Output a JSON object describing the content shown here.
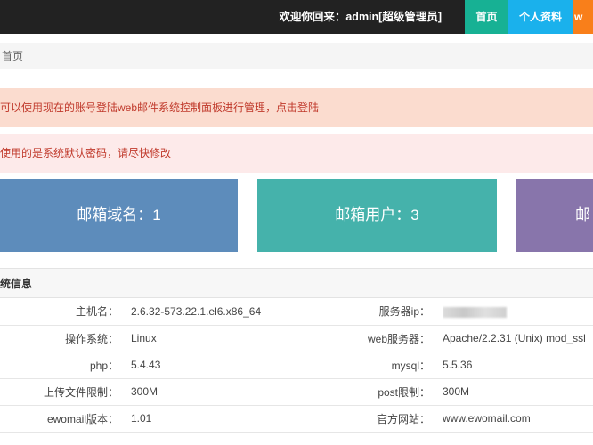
{
  "header": {
    "welcome_text": "欢迎你回来：admin[超级管理员]",
    "nav": [
      {
        "label": "首页",
        "color": "#17b194"
      },
      {
        "label": "个人资料",
        "color": "#1ab1ec"
      },
      {
        "label": "w",
        "color": "#f97f1a"
      }
    ]
  },
  "breadcrumb": {
    "current": "首页"
  },
  "alerts": [
    {
      "text": "可以使用现在的账号登陆web邮件系统控制面板进行管理，点击登陆"
    },
    {
      "text": "使用的是系统默认密码，请尽快修改"
    }
  ],
  "stats": [
    {
      "label": "邮箱域名：1",
      "color": "#5d8cbb"
    },
    {
      "label": "邮箱用户：3",
      "color": "#45b2ab"
    },
    {
      "label": "邮",
      "color": "#8875ab"
    }
  ],
  "system_info": {
    "title": "统信息",
    "rows": [
      {
        "label1": "主机名：",
        "value1": "2.6.32-573.22.1.el6.x86_64",
        "label2": "服务器ip：",
        "value2": ""
      },
      {
        "label1": "操作系统：",
        "value1": "Linux",
        "label2": "web服务器：",
        "value2": "Apache/2.2.31 (Unix) mod_ssl"
      },
      {
        "label1": "php：",
        "value1": "5.4.43",
        "label2": "mysql：",
        "value2": "5.5.36"
      },
      {
        "label1": "上传文件限制：",
        "value1": "300M",
        "label2": "post限制：",
        "value2": "300M"
      },
      {
        "label1": "ewomail版本：",
        "value1": "1.01",
        "label2": "官方网站：",
        "value2": "www.ewomail.com"
      }
    ]
  }
}
